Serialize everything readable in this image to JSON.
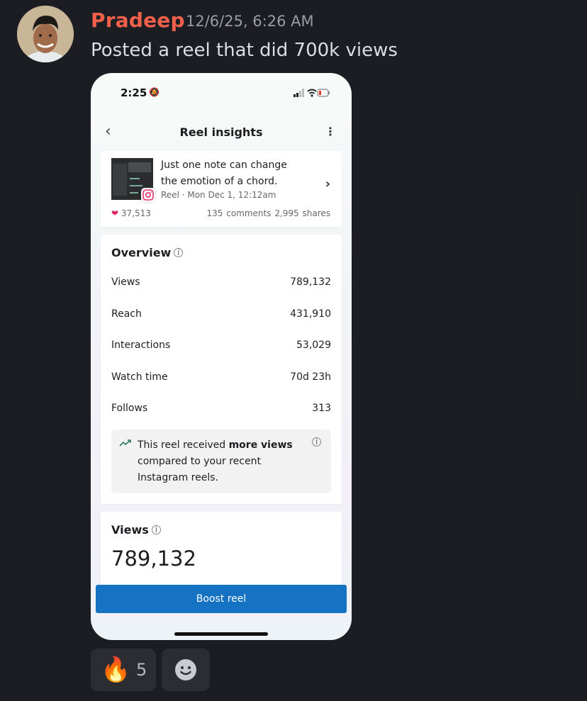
{
  "author": {
    "name": "Pradeep",
    "timestamp": "12/6/25, 6:26 AM"
  },
  "message": {
    "text": "Posted a reel that did 700k views"
  },
  "phone": {
    "status_time": "2:25",
    "nav": {
      "back_icon": "chevron-left-icon",
      "title": "Reel insights",
      "more_icon": "more-vertical-icon"
    },
    "post": {
      "caption_line1": "Just one note can change",
      "caption_line2": "the emotion of a chord.",
      "meta": "Reel · Mon Dec 1, 12:12am",
      "likes": "37,513",
      "comments": "135 comments",
      "shares": "2,995 shares"
    },
    "overview": {
      "title": "Overview",
      "rows": [
        {
          "label": "Views",
          "value": "789,132"
        },
        {
          "label": "Reach",
          "value": "431,910"
        },
        {
          "label": "Interactions",
          "value": "53,029"
        },
        {
          "label": "Watch time",
          "value": "70d 23h"
        },
        {
          "label": "Follows",
          "value": "313"
        }
      ],
      "insight_pre": "This reel received ",
      "insight_bold": "more views",
      "insight_line2": "compared to your recent",
      "insight_line3": "Instagram reels."
    },
    "views_card": {
      "title": "Views",
      "total": "789,132"
    },
    "boost_label": "Boost reel"
  },
  "reactions": [
    {
      "emoji": "🔥",
      "count": "5"
    },
    {
      "icon": "add-reaction-icon"
    }
  ],
  "colors": {
    "username": "#f0604a",
    "background": "#1c1d23",
    "boost": "#1673c3"
  }
}
